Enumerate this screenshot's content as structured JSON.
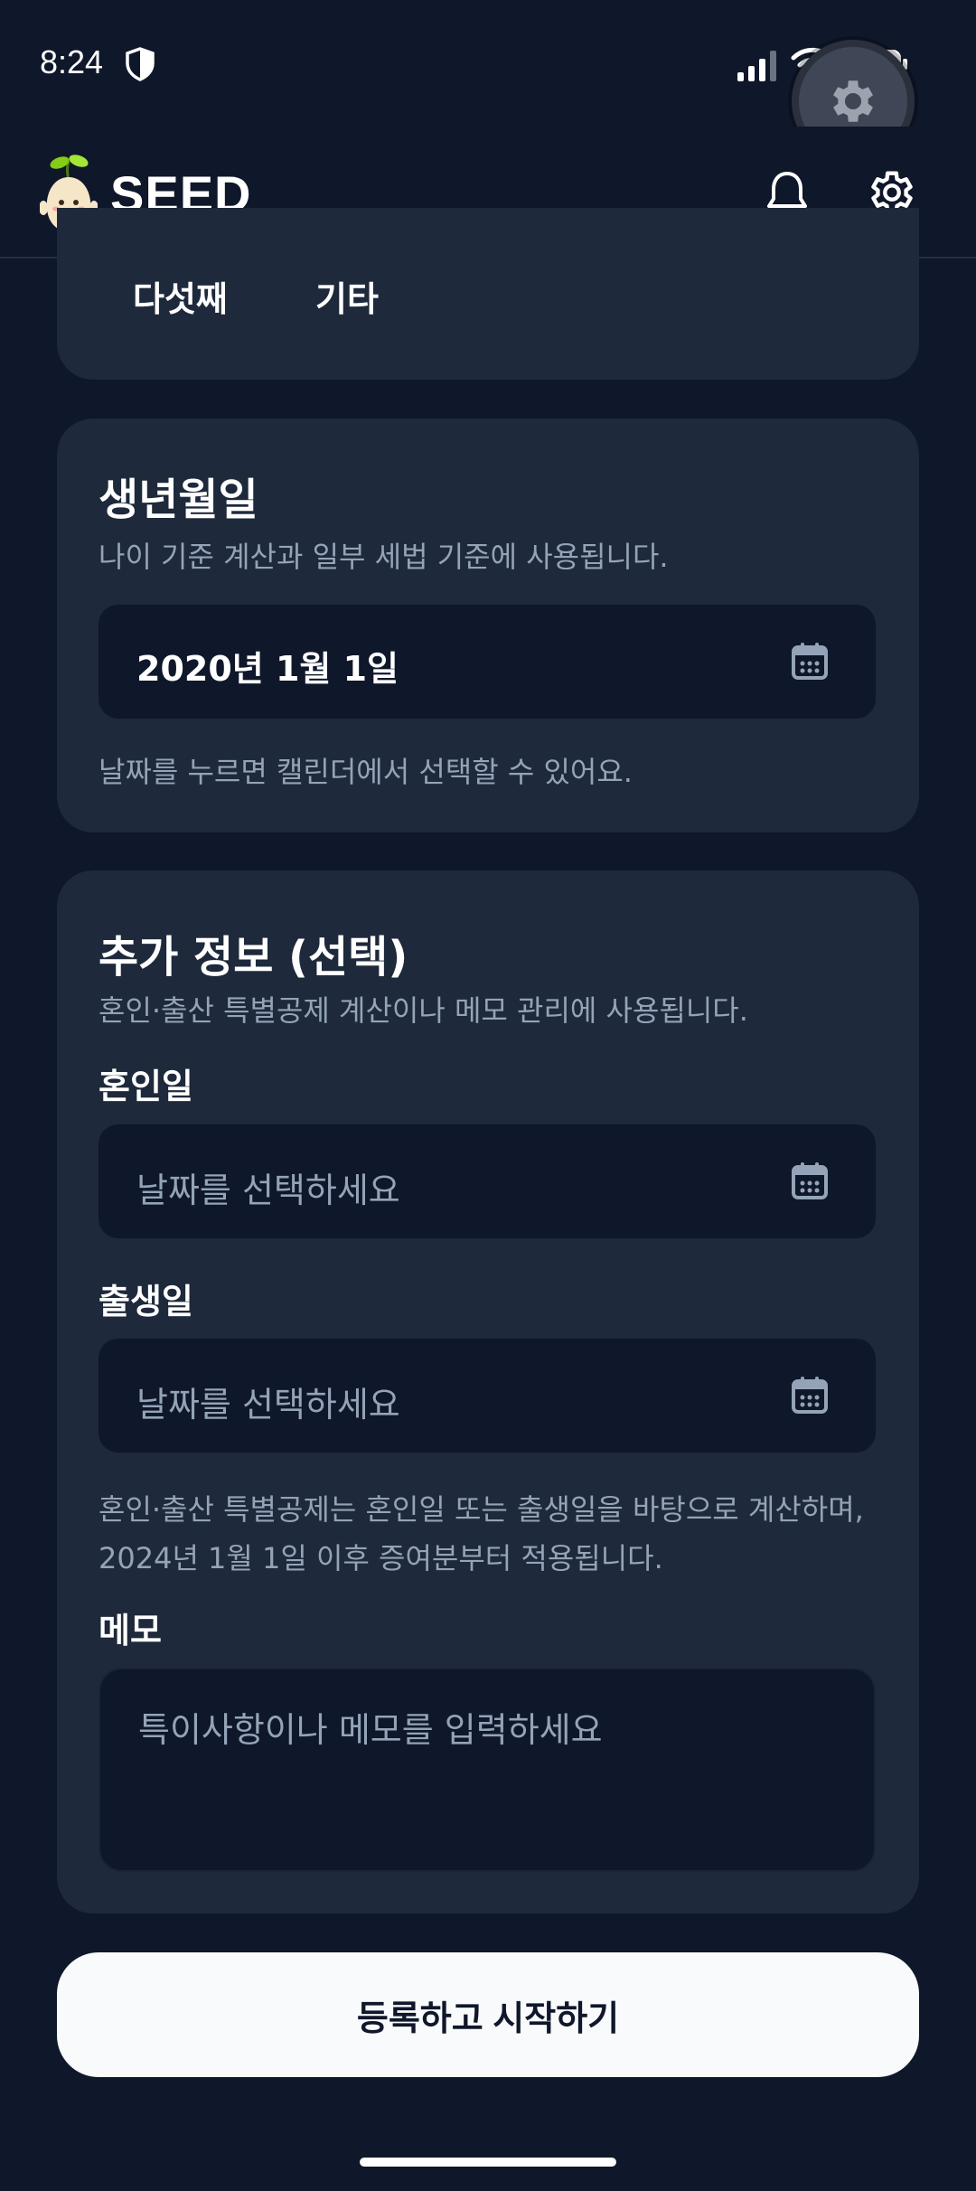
{
  "status_bar": {
    "time": "8:24",
    "icons": [
      "shield-icon",
      "signal-icon",
      "wifi-icon",
      "battery-icon"
    ]
  },
  "header": {
    "title": "SEED",
    "icons": [
      "sprout-mascot-logo",
      "bell-icon",
      "gear-icon"
    ]
  },
  "top_card": {
    "options": [
      "다섯째",
      "기타"
    ]
  },
  "birth_card": {
    "title": "생년월일",
    "description": "나이 기준 계산과 일부 세법 기준에 사용됩니다.",
    "date_value": "2020년 1월 1일",
    "hint": "날짜를 누르면 캘린더에서 선택할 수 있어요."
  },
  "extra_card": {
    "title": "추가 정보 (선택)",
    "description": "혼인·출산 특별공제 계산이나 메모 관리에 사용됩니다.",
    "marriage_label": "혼인일",
    "marriage_placeholder": "날짜를 선택하세요",
    "birth_label": "출생일",
    "birth_placeholder": "날짜를 선택하세요",
    "hint": "혼인·출산 특별공제는 혼인일 또는 출생일을 바탕으로 계산하며, 2024년 1월 1일 이후 증여분부터 적용됩니다.",
    "memo_label": "메모",
    "memo_placeholder": "특이사항이나 메모를 입력하세요"
  },
  "submit_button": {
    "label": "등록하고 시작하기"
  },
  "colors": {
    "background": "#0f172a",
    "card": "#1e293b",
    "input": "#0f172a",
    "muted_text": "#94a3b8",
    "button": "#f8fafc"
  }
}
